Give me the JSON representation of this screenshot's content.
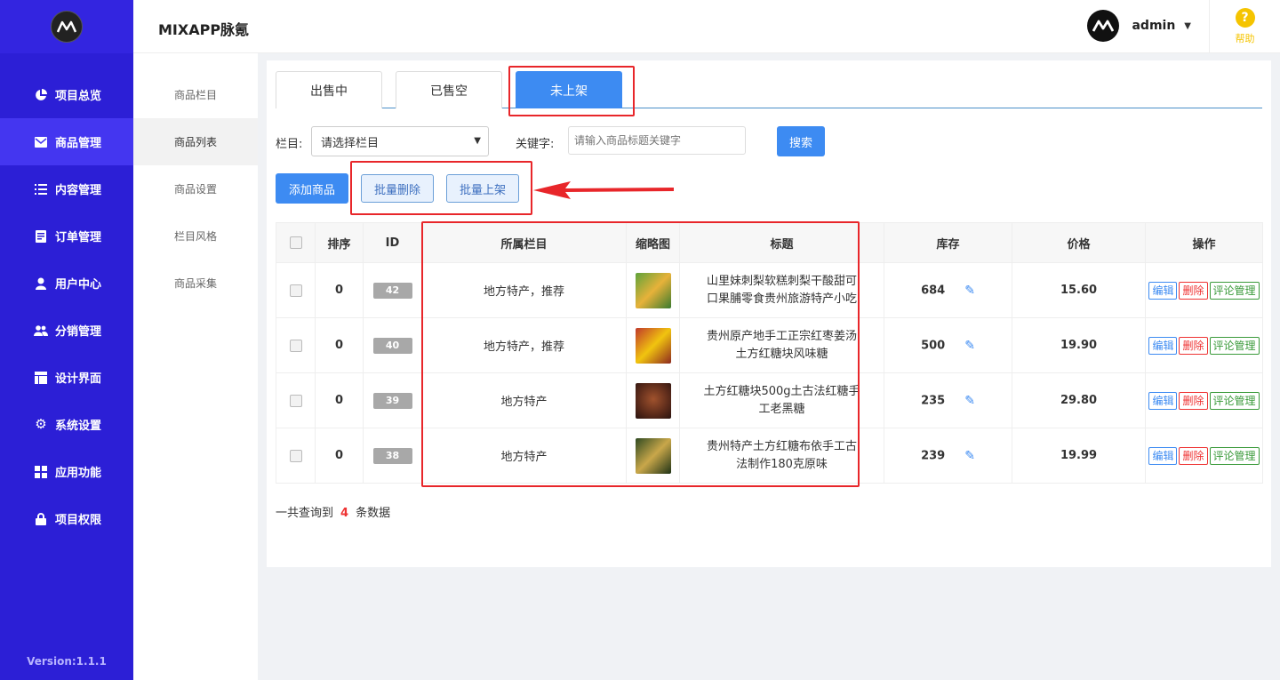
{
  "sidebar": {
    "logo_icon": "mixapp-logo-icon",
    "items": [
      {
        "label": "项目总览",
        "icon": "pie-chart-icon"
      },
      {
        "label": "商品管理",
        "icon": "envelope-icon"
      },
      {
        "label": "内容管理",
        "icon": "list-icon"
      },
      {
        "label": "订单管理",
        "icon": "document-icon"
      },
      {
        "label": "用户中心",
        "icon": "user-icon"
      },
      {
        "label": "分销管理",
        "icon": "users-icon"
      },
      {
        "label": "设计界面",
        "icon": "layout-icon"
      },
      {
        "label": "系统设置",
        "icon": "gear-icon"
      },
      {
        "label": "应用功能",
        "icon": "grid-icon"
      },
      {
        "label": "项目权限",
        "icon": "lock-icon"
      }
    ],
    "active_index": 1,
    "version": "Version:1.1.1",
    "color": "#2c1fd6"
  },
  "subnav": {
    "items": [
      "商品栏目",
      "商品列表",
      "商品设置",
      "栏目风格",
      "商品采集"
    ],
    "active_index": 1
  },
  "header": {
    "brand": "MIXAPP脉氪",
    "username": "admin",
    "help_label": "帮助",
    "help_glyph": "?"
  },
  "tabs": {
    "items": [
      "出售中",
      "已售空",
      "未上架"
    ],
    "active_index": 2
  },
  "filter": {
    "category_label": "栏目:",
    "category_value": "请选择栏目",
    "keyword_label": "关键字:",
    "keyword_placeholder": "请输入商品标题关键字",
    "search_label": "搜索"
  },
  "actions": {
    "add_label": "添加商品",
    "batch_delete_label": "批量删除",
    "batch_publish_label": "批量上架"
  },
  "table": {
    "headers": {
      "order": "排序",
      "id": "ID",
      "category": "所属栏目",
      "thumb": "缩略图",
      "title": "标题",
      "stock": "库存",
      "price": "价格",
      "ops": "操作"
    },
    "rows": [
      {
        "order": "0",
        "id": "42",
        "category": "地方特产，推荐",
        "title_line1": "山里妹刺梨软糕刺梨干酸甜可",
        "title_line2": "口果脯零食贵州旅游特产小吃",
        "stock": "684",
        "price": "15.60",
        "thumb_color": "#3a7a2e"
      },
      {
        "order": "0",
        "id": "40",
        "category": "地方特产，推荐",
        "title_line1": "贵州原产地手工正宗红枣姜汤",
        "title_line2": "土方红糖块风味糖",
        "stock": "500",
        "price": "19.90",
        "thumb_color": "#c0392b"
      },
      {
        "order": "0",
        "id": "39",
        "category": "地方特产",
        "title_line1": "土方红糖块500g土古法红糖手",
        "title_line2": "工老黑糖",
        "stock": "235",
        "price": "29.80",
        "thumb_color": "#5a2a1a"
      },
      {
        "order": "0",
        "id": "38",
        "category": "地方特产",
        "title_line1": "贵州特产土方红糖布依手工古",
        "title_line2": "法制作180克原味",
        "stock": "239",
        "price": "19.99",
        "thumb_color": "#2f4a22"
      }
    ],
    "op_edit": "编辑",
    "op_delete": "删除",
    "op_comment": "评论管理"
  },
  "summary": {
    "prefix": "一共查询到",
    "count": "4",
    "suffix": "条数据"
  },
  "colors": {
    "accent": "#3d8bf2",
    "annotation": "#e8262a"
  }
}
